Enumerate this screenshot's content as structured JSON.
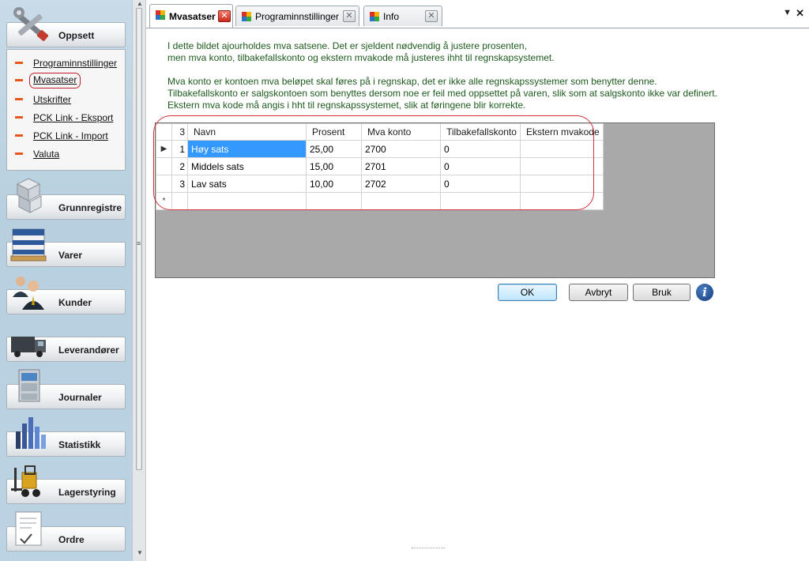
{
  "sidebar": {
    "sections": [
      {
        "label": "Oppsett",
        "icon": "tools-icon"
      },
      {
        "label": "Grunnregistre",
        "icon": "cubes-icon"
      },
      {
        "label": "Varer",
        "icon": "pallet-boxes-icon"
      },
      {
        "label": "Kunder",
        "icon": "customers-icon"
      },
      {
        "label": "Leverandører",
        "icon": "truck-icon"
      },
      {
        "label": "Journaler",
        "icon": "filing-cabinet-icon"
      },
      {
        "label": "Statistikk",
        "icon": "bar-chart-icon"
      },
      {
        "label": "Lagerstyring",
        "icon": "forklift-icon"
      },
      {
        "label": "Ordre",
        "icon": "order-document-icon"
      }
    ],
    "submenu": [
      "Programinnstillinger",
      "Mvasatser",
      "Utskrifter",
      "PCK Link - Eksport",
      "PCK Link - Import",
      "Valuta"
    ],
    "active_item": "Mvasatser"
  },
  "tabs": [
    {
      "label": "Mvasatser",
      "active": true
    },
    {
      "label": "Programinnstillinger",
      "active": false
    },
    {
      "label": "Info",
      "active": false
    }
  ],
  "info_text": [
    "I dette bildet ajourholdes mva satsene. Det er sjeldent nødvendig å justere prosenten,",
    "men mva konto, tilbakefallskonto og ekstern mvakode må justeres ihht til regnskapsystemet.",
    "Mva konto er kontoen mva beløpet skal føres på i regnskap, det er ikke alle regnskapssystemer som benytter denne.",
    "Tilbakefallskonto er salgskontoen som benyttes dersom noe er feil med oppsettet på varen, slik som at salgskonto ikke var definert.",
    "Ekstern mva kode må angis i hht til regnskapssystemet, slik at føringene blir korrekte."
  ],
  "grid": {
    "row_count": "3",
    "columns": [
      "Navn",
      "Prosent",
      "Mva konto",
      "Tilbakefallskonto",
      "Ekstern mvakode"
    ],
    "rows": [
      {
        "num": "1",
        "navn": "Høy sats",
        "prosent": "25,00",
        "mva_konto": "2700",
        "tilbakefall": "0",
        "ekstern": ""
      },
      {
        "num": "2",
        "navn": "Middels sats",
        "prosent": "15,00",
        "mva_konto": "2701",
        "tilbakefall": "0",
        "ekstern": ""
      },
      {
        "num": "3",
        "navn": "Lav sats",
        "prosent": "10,00",
        "mva_konto": "2702",
        "tilbakefall": "0",
        "ekstern": ""
      }
    ],
    "current_row_marker": "▶",
    "new_row_marker": "*"
  },
  "buttons": {
    "ok": "OK",
    "cancel": "Avbryt",
    "apply": "Bruk",
    "info": "i"
  },
  "colors": {
    "info_text": "#1d5a1d",
    "highlight": "#d0323c",
    "selection": "#3399ff",
    "sub_dash": "#e8581c"
  }
}
